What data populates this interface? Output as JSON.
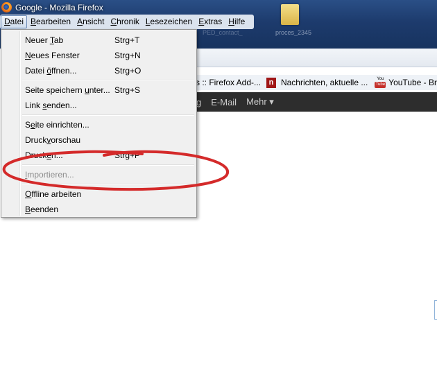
{
  "window": {
    "title": "Google - Mozilla Firefox",
    "icon": "firefox-icon"
  },
  "desktop": {
    "folder_label": "proces_2345",
    "faded_label": "PED_contact_"
  },
  "menubar": {
    "items": [
      {
        "label": "Datei",
        "ul": "D",
        "rest": "atei",
        "active": true
      },
      {
        "label": "Bearbeiten",
        "ul": "B",
        "rest": "earbeiten"
      },
      {
        "label": "Ansicht",
        "ul": "A",
        "rest": "nsicht"
      },
      {
        "label": "Chronik",
        "ul": "C",
        "rest": "hronik"
      },
      {
        "label": "Lesezeichen",
        "ul": "L",
        "rest": "esezeichen"
      },
      {
        "label": "Extras",
        "ul": "E",
        "rest": "xtras"
      },
      {
        "label": "Hilfe",
        "ul": "H",
        "rest": "ilfe"
      }
    ]
  },
  "bookmarks": {
    "item1": "s :: Firefox Add-...",
    "item2": "Nachrichten, aktuelle ...",
    "item2_icon_letter": "n",
    "item3": "YouTube - Br",
    "yt_top": "You",
    "yt_bottom": "Tube"
  },
  "google_bar": {
    "lead": "g",
    "email": "E-Mail",
    "more": "Mehr ▾"
  },
  "datei_menu": {
    "new_tab": {
      "pre": "Neuer ",
      "ul": "T",
      "post": "ab",
      "shortcut": "Strg+T"
    },
    "new_window": {
      "pre": "",
      "ul": "N",
      "post": "eues Fenster",
      "shortcut": "Strg+N"
    },
    "open_file": {
      "pre": "Datei ",
      "ul": "ö",
      "post": "ffnen...",
      "shortcut": "Strg+O"
    },
    "save_page": {
      "pre": "Seite speichern ",
      "ul": "u",
      "post": "nter...",
      "shortcut": "Strg+S"
    },
    "send_link": {
      "pre": "Link ",
      "ul": "s",
      "post": "enden..."
    },
    "page_setup": {
      "pre": "S",
      "ul": "e",
      "post": "ite einrichten..."
    },
    "print_preview": {
      "pre": "Druck",
      "ul": "v",
      "post": "orschau"
    },
    "print": {
      "pre": "Druck",
      "ul": "e",
      "post": "n...",
      "shortcut": "Strg+P"
    },
    "import": {
      "pre": "",
      "ul": "I",
      "post": "mportieren..."
    },
    "offline": {
      "pre": "",
      "ul": "O",
      "post": "ffline arbeiten"
    },
    "quit": {
      "pre": "",
      "ul": "B",
      "post": "eenden"
    }
  },
  "colors": {
    "annotation": "#d42a2a",
    "google_bar": "#2d2d2d",
    "desktop": "#1d3b6d"
  }
}
